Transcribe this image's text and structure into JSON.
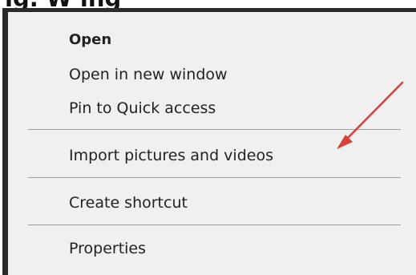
{
  "heading_fragment": "ig. W ing",
  "menu": {
    "items": [
      {
        "id": "open",
        "label": "Open",
        "bold": true
      },
      {
        "id": "open-new-window",
        "label": "Open in new window",
        "bold": false
      },
      {
        "id": "pin-quick-access",
        "label": "Pin to Quick access",
        "bold": false
      },
      {
        "id": "import-pictures",
        "label": "Import pictures and videos",
        "bold": false
      },
      {
        "id": "create-shortcut",
        "label": "Create shortcut",
        "bold": false
      },
      {
        "id": "properties",
        "label": "Properties",
        "bold": false
      }
    ]
  },
  "annotation": {
    "icon": "arrow-icon",
    "color": "#d9403a"
  },
  "colors": {
    "menu_background": "#f0f0f0",
    "menu_frame": "#2b2b2b",
    "separator": "#a0a0a0",
    "text": "#222222"
  }
}
